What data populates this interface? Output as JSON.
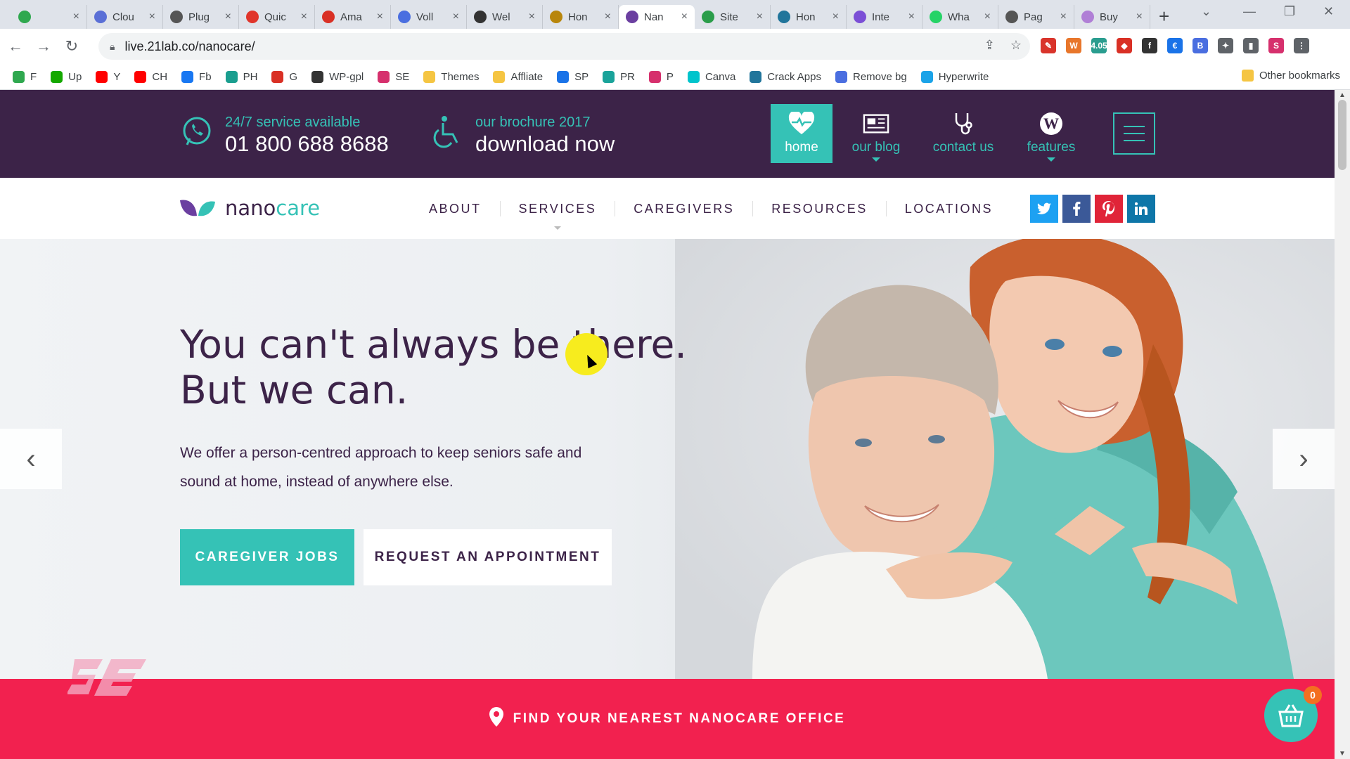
{
  "browser": {
    "tabs": [
      {
        "label": "",
        "color": "#2fa84f",
        "active": false,
        "icon": "app-icon"
      },
      {
        "label": "Clou",
        "color": "#5a6fd6",
        "active": false,
        "icon": "cloud-icon"
      },
      {
        "label": "Plug",
        "color": "#555555",
        "active": false,
        "icon": "globe-icon"
      },
      {
        "label": "Quic",
        "color": "#e0352b",
        "active": false,
        "icon": "pin-icon"
      },
      {
        "label": "Ama",
        "color": "#d93025",
        "active": false,
        "icon": "gmail-icon"
      },
      {
        "label": "Voll",
        "color": "#4a6ee0",
        "active": false,
        "icon": "v-icon"
      },
      {
        "label": "Wel",
        "color": "#333333",
        "active": false,
        "icon": "circle-icon"
      },
      {
        "label": "Hon",
        "color": "#b8860b",
        "active": false,
        "icon": "book-icon"
      },
      {
        "label": "Nan",
        "color": "#6b3fa0",
        "active": true,
        "icon": "nanocare-icon"
      },
      {
        "label": "Site",
        "color": "#2a9d4a",
        "active": false,
        "icon": "site-icon"
      },
      {
        "label": "Hon",
        "color": "#21759b",
        "active": false,
        "icon": "wordpress-icon"
      },
      {
        "label": "Inte",
        "color": "#7b4fd6",
        "active": false,
        "icon": "loop-icon"
      },
      {
        "label": "Wha",
        "color": "#25d366",
        "active": false,
        "icon": "whatsapp-icon"
      },
      {
        "label": "Pag",
        "color": "#555555",
        "active": false,
        "icon": "globe-icon"
      },
      {
        "label": "Buy",
        "color": "#b07fd6",
        "active": false,
        "icon": "buy-icon"
      }
    ],
    "new_tab": "+",
    "url": "live.21lab.co/nanocare/",
    "extensions": [
      {
        "label": "✎",
        "color": "#d9342b"
      },
      {
        "label": "W",
        "color": "#e8762b"
      },
      {
        "label": "4.05",
        "color": "#2a9d8f"
      },
      {
        "label": "◆",
        "color": "#d93025"
      },
      {
        "label": "f",
        "color": "#333333"
      },
      {
        "label": "€",
        "color": "#1a73e8"
      },
      {
        "label": "B",
        "color": "#4a6ee0"
      },
      {
        "label": "✦",
        "color": "#5f6368"
      },
      {
        "label": "▮",
        "color": "#5f6368"
      },
      {
        "label": "S",
        "color": "#d6306d"
      },
      {
        "label": "⋮",
        "color": "#5f6368"
      }
    ],
    "bookmarks": [
      {
        "label": "F",
        "color": "#2fa84f"
      },
      {
        "label": "Up",
        "color": "#14a800"
      },
      {
        "label": "Y",
        "color": "#ff0000"
      },
      {
        "label": "CH",
        "color": "#ff0000"
      },
      {
        "label": "Fb",
        "color": "#1877f2"
      },
      {
        "label": "PH",
        "color": "#1a9e8f"
      },
      {
        "label": "G",
        "color": "#d93025"
      },
      {
        "label": "WP-gpl",
        "color": "#333333"
      },
      {
        "label": "SE",
        "color": "#d6306d"
      },
      {
        "label": "Themes",
        "color": "#f5c542"
      },
      {
        "label": "Affliate",
        "color": "#f5c542"
      },
      {
        "label": "SP",
        "color": "#1a73e8"
      },
      {
        "label": "PR",
        "color": "#1aa39a"
      },
      {
        "label": "P",
        "color": "#d6306d"
      },
      {
        "label": "Canva",
        "color": "#00c4cc"
      },
      {
        "label": "Crack Apps",
        "color": "#21759b"
      },
      {
        "label": "Remove bg",
        "color": "#4a6ee0"
      },
      {
        "label": "Hyperwrite",
        "color": "#1ba3e8"
      }
    ],
    "other_bookmarks": "Other bookmarks"
  },
  "site": {
    "colors": {
      "purple": "#3c2348",
      "teal": "#35c2b6",
      "pink": "#f2214f"
    },
    "topbar": {
      "service_small": "24/7 service available",
      "service_big": "01 800 688 8688",
      "brochure_small": "our brochure 2017",
      "brochure_big": "download now",
      "nav": [
        {
          "label": "home",
          "icon": "heart-pulse-icon",
          "active": true
        },
        {
          "label": "our blog",
          "icon": "newspaper-icon",
          "active": false
        },
        {
          "label": "contact us",
          "icon": "stethoscope-icon",
          "active": false
        },
        {
          "label": "features",
          "icon": "wordpress-icon",
          "active": false
        }
      ]
    },
    "logo": {
      "part1": "nano",
      "part2": "care"
    },
    "menu": [
      "ABOUT",
      "SERVICES",
      "CAREGIVERS",
      "RESOURCES",
      "LOCATIONS"
    ],
    "socials": [
      {
        "name": "twitter",
        "glyph": "t",
        "color": "#1da1f2"
      },
      {
        "name": "facebook",
        "glyph": "f",
        "color": "#3b5998"
      },
      {
        "name": "pinterest",
        "glyph": "P",
        "color": "#e02438"
      },
      {
        "name": "linkedin",
        "glyph": "in",
        "color": "#0e76a8"
      }
    ],
    "hero": {
      "title": "You can't always be there.\nBut we can.",
      "description": "We offer a person-centred approach to keep seniors safe and sound at home, instead of anywhere else.",
      "btn_primary": "CAREGIVER JOBS",
      "btn_secondary": "REQUEST AN APPOINTMENT",
      "prev": "‹",
      "next": "›"
    },
    "office_bar": "FIND YOUR NEAREST NANOCARE OFFICE",
    "cart_count": "0"
  }
}
